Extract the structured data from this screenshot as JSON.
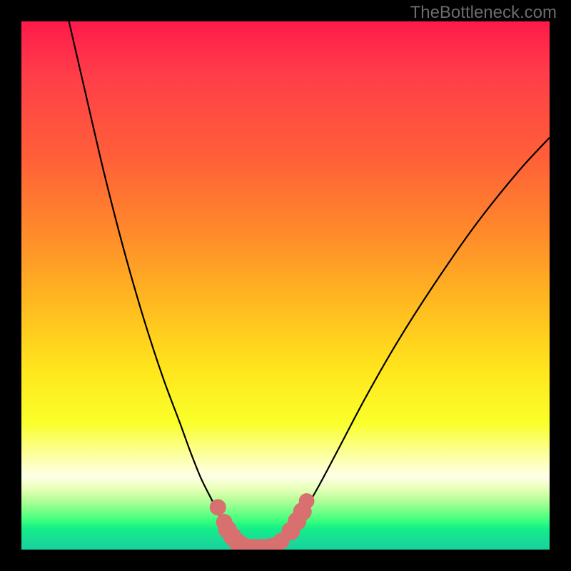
{
  "watermark": "TheBottleneck.com",
  "colors": {
    "frame": "#000000",
    "curve": "#000000",
    "marker_fill": "#d87070",
    "marker_stroke": "#c05858"
  },
  "chart_data": {
    "type": "line",
    "title": "",
    "xlabel": "",
    "ylabel": "",
    "xlim": [
      0,
      100
    ],
    "ylim": [
      0,
      100
    ],
    "annotations": [],
    "series": [
      {
        "name": "left-curve",
        "x": [
          9,
          12,
          15,
          18,
          21,
          24,
          27,
          30,
          32,
          34,
          36,
          37.5,
          39,
          40.5,
          41.5,
          42.5
        ],
        "y": [
          100,
          87,
          74,
          62,
          51,
          41,
          32,
          24,
          18.5,
          13.5,
          9.5,
          6.5,
          4.2,
          2.3,
          1.0,
          0.25
        ]
      },
      {
        "name": "right-curve",
        "x": [
          47.5,
          49,
          51,
          53,
          56,
          60,
          65,
          71,
          78,
          86,
          94,
          100
        ],
        "y": [
          0.25,
          1.2,
          3.4,
          6.4,
          11.5,
          19,
          28.5,
          39,
          50,
          61.5,
          71.5,
          78
        ]
      },
      {
        "name": "flat-bottom",
        "x": [
          42.5,
          47.5
        ],
        "y": [
          0.25,
          0.25
        ]
      }
    ],
    "markers": [
      {
        "x": 37.2,
        "y": 8.0,
        "r": 1.5
      },
      {
        "x": 38.4,
        "y": 5.2,
        "r": 1.5
      },
      {
        "x": 39.0,
        "y": 3.8,
        "r": 2.0
      },
      {
        "x": 40.0,
        "y": 2.4,
        "r": 2.0
      },
      {
        "x": 41.0,
        "y": 1.3,
        "r": 2.0
      },
      {
        "x": 42.0,
        "y": 0.6,
        "r": 2.0
      },
      {
        "x": 43.0,
        "y": 0.3,
        "r": 2.0
      },
      {
        "x": 44.25,
        "y": 0.25,
        "r": 2.0
      },
      {
        "x": 45.5,
        "y": 0.25,
        "r": 2.0
      },
      {
        "x": 46.75,
        "y": 0.3,
        "r": 2.0
      },
      {
        "x": 47.9,
        "y": 0.6,
        "r": 2.0
      },
      {
        "x": 49.2,
        "y": 1.6,
        "r": 1.5
      },
      {
        "x": 51.0,
        "y": 3.5,
        "r": 2.0
      },
      {
        "x": 52.2,
        "y": 5.4,
        "r": 2.0
      },
      {
        "x": 53.2,
        "y": 7.2,
        "r": 2.0
      },
      {
        "x": 54.0,
        "y": 9.2,
        "r": 1.3
      }
    ]
  }
}
